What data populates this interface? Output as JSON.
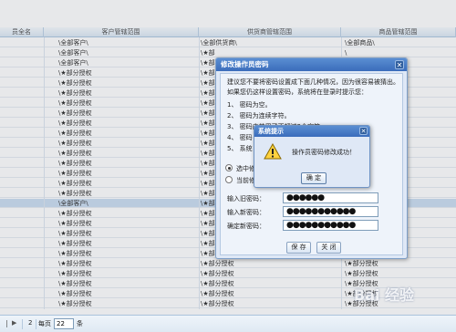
{
  "grid": {
    "columns": [
      "员全名",
      "客户管辖范围",
      "供货商管辖范围",
      "商品管辖范围"
    ],
    "rows": [
      [
        "",
        "\\全部客户\\",
        "\\全部供货商\\",
        "\\全部商品\\"
      ],
      [
        "",
        "\\全部客户\\",
        "\\★部",
        "\\"
      ],
      [
        "",
        "\\全部客户\\",
        "\\★部",
        "\\"
      ],
      [
        "",
        "\\★部分授权",
        "\\★部",
        "\\"
      ],
      [
        "",
        "\\★部分授权",
        "\\★部",
        "\\"
      ],
      [
        "",
        "\\★部分授权",
        "\\★部",
        "\\"
      ],
      [
        "",
        "\\★部分授权",
        "\\★部",
        "\\"
      ],
      [
        "",
        "\\★部分授权",
        "\\★部",
        "\\"
      ],
      [
        "",
        "\\★部分授权",
        "\\★部",
        "\\"
      ],
      [
        "",
        "\\★部分授权",
        "\\★部",
        "\\"
      ],
      [
        "",
        "\\★部分授权",
        "\\★部",
        "\\"
      ],
      [
        "",
        "\\★部分授权",
        "\\★部",
        "\\"
      ],
      [
        "",
        "\\★部分授权",
        "\\★部",
        "\\"
      ],
      [
        "",
        "\\★部分授权",
        "\\★部",
        "\\"
      ],
      [
        "",
        "\\★部分授权",
        "\\★部",
        "\\"
      ],
      [
        "",
        "\\★部分授权",
        "\\★部",
        "\\"
      ],
      [
        "",
        "\\全部客户\\",
        "\\★部",
        "\\"
      ],
      [
        "",
        "\\★部分授权",
        "\\★部",
        "\\"
      ],
      [
        "",
        "\\★部分授权",
        "\\★部",
        "\\"
      ],
      [
        "",
        "\\★部分授权",
        "\\★部",
        "\\"
      ],
      [
        "",
        "\\★部分授权",
        "\\★部",
        "\\"
      ],
      [
        "",
        "\\★部分授权",
        "\\★部",
        "\\"
      ],
      [
        "",
        "\\★部分授权",
        "\\★部分授权",
        "\\★部分授权"
      ],
      [
        "",
        "\\★部分授权",
        "\\★部分授权",
        "\\★部分授权"
      ],
      [
        "",
        "\\★部分授权",
        "\\★部分授权",
        "\\★部分授权"
      ],
      [
        "",
        "\\★部分授权",
        "\\★部分授权",
        "\\★部分授权"
      ],
      [
        "",
        "\\★部分授权",
        "\\★部分授权",
        "\\★部分授权"
      ]
    ]
  },
  "pager": {
    "page": "2",
    "per_page_label": "每页",
    "per_page_value": "22",
    "unit": "条"
  },
  "dialog": {
    "title": "修改操作员密码",
    "lines": [
      "建议您不要将密码设置成下面几种情况，因为很容易被猜出。",
      "如果您仍这样设置密码，系统将在登录时提示您：",
      "1、 密码为空。",
      "2、 密码为连续字符。",
      "3、 密码由共用了不超过2个字符。",
      "4、 密码",
      "5、 系统"
    ],
    "radio1": "选中修",
    "radio2": "当前修",
    "old_label": "输入旧密码：",
    "old_value": "●●●●●●",
    "new_label": "输入新密码：",
    "new_value": "●●●●●●●●●●●",
    "confirm_label": "确定新密码：",
    "confirm_value": "●●●●●●●●●●●",
    "save": "保 存",
    "close": "关 闭"
  },
  "alert": {
    "title": "系统提示",
    "message": "操作员密码修改成功！",
    "ok": "确 定"
  },
  "watermark": "Bai 经验"
}
